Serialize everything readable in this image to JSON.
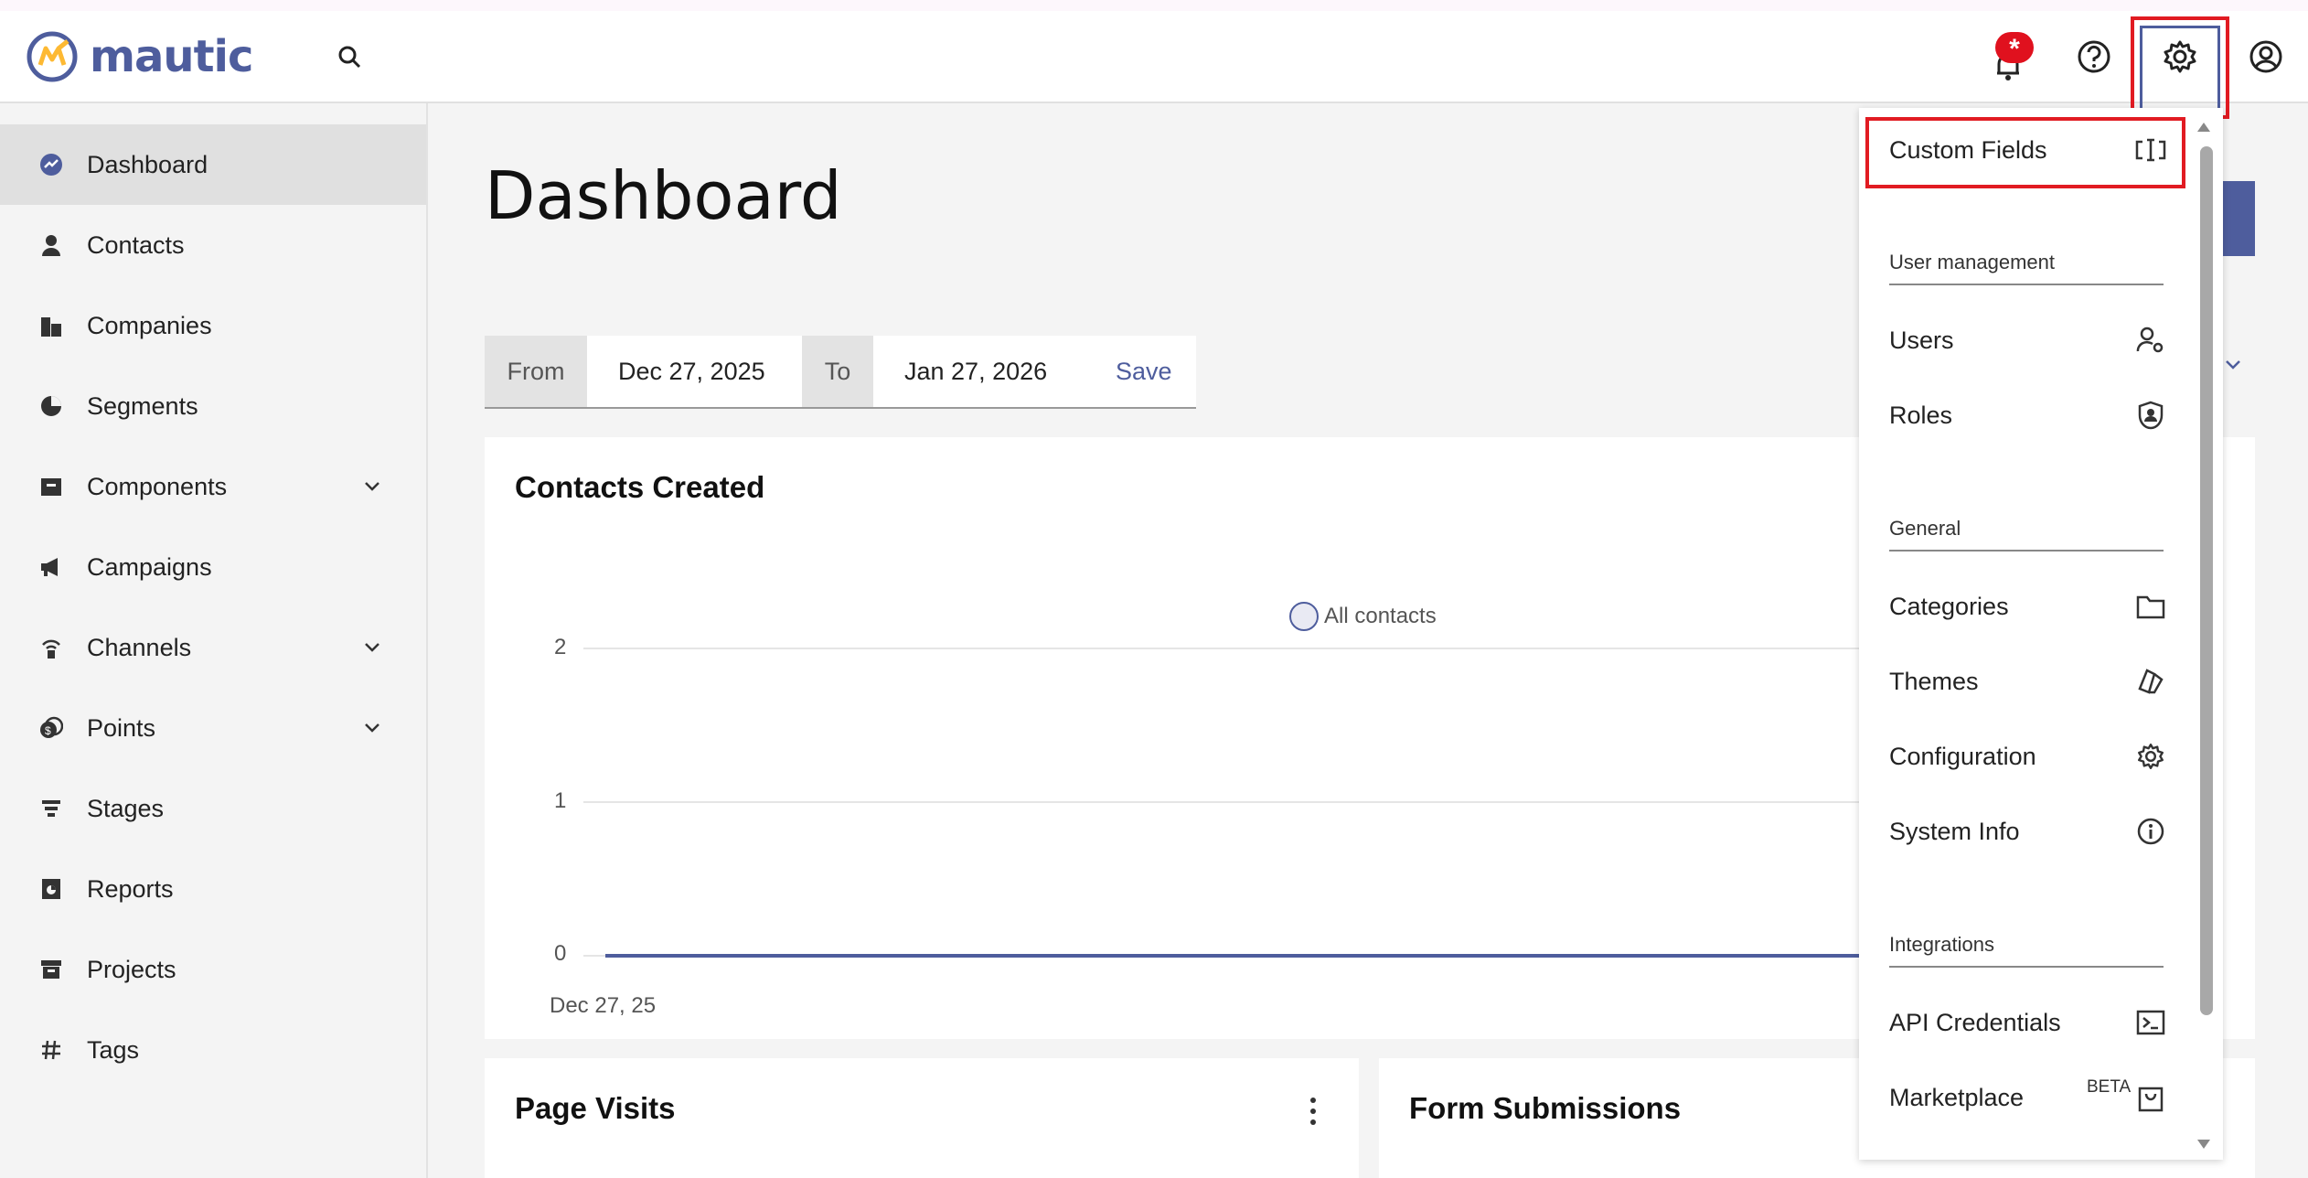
{
  "header": {
    "logo_text": "mautic",
    "notification_badge": "*",
    "icons": [
      "search-icon",
      "bell-icon",
      "help-icon",
      "gear-icon",
      "user-icon"
    ]
  },
  "sidebar": {
    "items": [
      {
        "label": "Dashboard",
        "icon": "dashboard-icon",
        "active": true
      },
      {
        "label": "Contacts",
        "icon": "person-icon"
      },
      {
        "label": "Companies",
        "icon": "building-icon"
      },
      {
        "label": "Segments",
        "icon": "pie-icon"
      },
      {
        "label": "Components",
        "icon": "box-icon",
        "expandable": true
      },
      {
        "label": "Campaigns",
        "icon": "megaphone-icon"
      },
      {
        "label": "Channels",
        "icon": "broadcast-icon",
        "expandable": true
      },
      {
        "label": "Points",
        "icon": "coins-icon",
        "expandable": true
      },
      {
        "label": "Stages",
        "icon": "funnel-icon"
      },
      {
        "label": "Reports",
        "icon": "report-icon"
      },
      {
        "label": "Projects",
        "icon": "archive-icon"
      },
      {
        "label": "Tags",
        "icon": "hash-icon"
      }
    ]
  },
  "main": {
    "title": "Dashboard",
    "daterange": {
      "from_label": "From",
      "from_value": "Dec 27, 2025",
      "to_label": "To",
      "to_value": "Jan 27, 2026",
      "save_label": "Save"
    },
    "contacts_card": {
      "title": "Contacts Created",
      "legend": "All contacts",
      "y_ticks": [
        "2",
        "1",
        "0"
      ],
      "x_tick": "Dec 27, 25"
    },
    "page_visits_title": "Page Visits",
    "form_submissions_title": "Form Submissions"
  },
  "chart_data": {
    "type": "line",
    "title": "Contacts Created",
    "x": [
      "Dec 27, 25"
    ],
    "series": [
      {
        "name": "All contacts",
        "values": [
          0
        ]
      }
    ],
    "ylim": [
      0,
      2
    ],
    "y_ticks": [
      0,
      1,
      2
    ],
    "legend": "top"
  },
  "dropdown": {
    "custom_fields": "Custom Fields",
    "section_user": "User management",
    "users": "Users",
    "roles": "Roles",
    "section_general": "General",
    "categories": "Categories",
    "themes": "Themes",
    "configuration": "Configuration",
    "system_info": "System Info",
    "section_integrations": "Integrations",
    "api_credentials": "API Credentials",
    "marketplace": "Marketplace",
    "beta": "BETA"
  },
  "colors": {
    "brand": "#4e5d9d",
    "accent": "#fdb933",
    "highlight": "#e11b22"
  }
}
